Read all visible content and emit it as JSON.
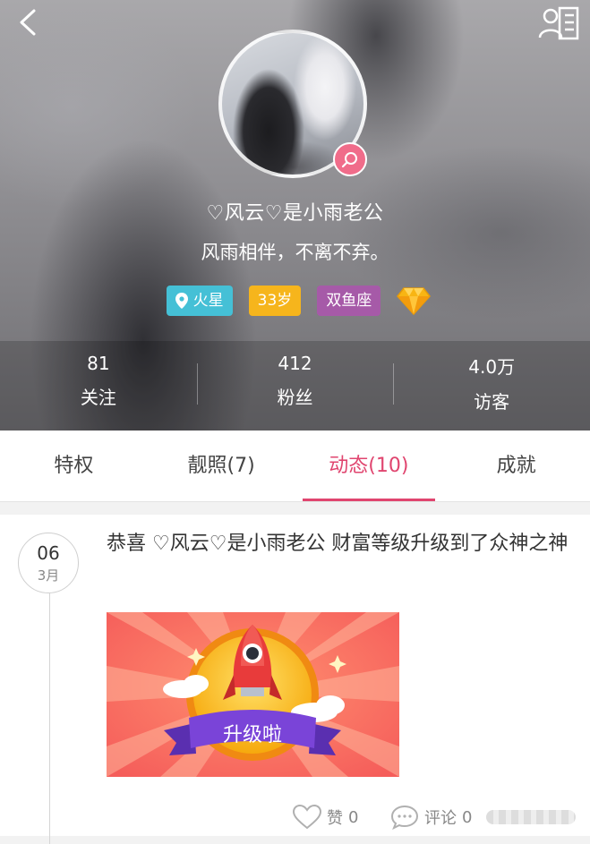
{
  "header": {
    "nickname": "♡风云♡是小雨老公",
    "signature": "风雨相伴，不离不弃。",
    "tags": {
      "location": "火星",
      "age": "33岁",
      "zodiac": "双鱼座"
    }
  },
  "stats": [
    {
      "value": "81",
      "label": "关注"
    },
    {
      "value": "412",
      "label": "粉丝"
    },
    {
      "value": "4.0万",
      "label": "访客"
    }
  ],
  "tabs": [
    {
      "label": "特权",
      "active": false
    },
    {
      "label": "靓照(7)",
      "active": false
    },
    {
      "label": "动态(10)",
      "active": true
    },
    {
      "label": "成就",
      "active": false
    }
  ],
  "post": {
    "date_day": "06",
    "date_month": "3月",
    "text": "恭喜 ♡风云♡是小雨老公 财富等级升级到了众神之神",
    "image_caption": "升级啦",
    "likes_label": "赞",
    "likes_count": "0",
    "comments_label": "评论",
    "comments_count": "0"
  },
  "colors": {
    "accent": "#e0456f",
    "tag_location": "#45c0d6",
    "tag_age": "#f6b51c",
    "tag_zodiac": "#a65aa8"
  },
  "icons": [
    "back-arrow-icon",
    "profile-card-icon",
    "search-icon",
    "location-pin-icon",
    "diamond-icon",
    "heart-icon",
    "comment-icon"
  ]
}
